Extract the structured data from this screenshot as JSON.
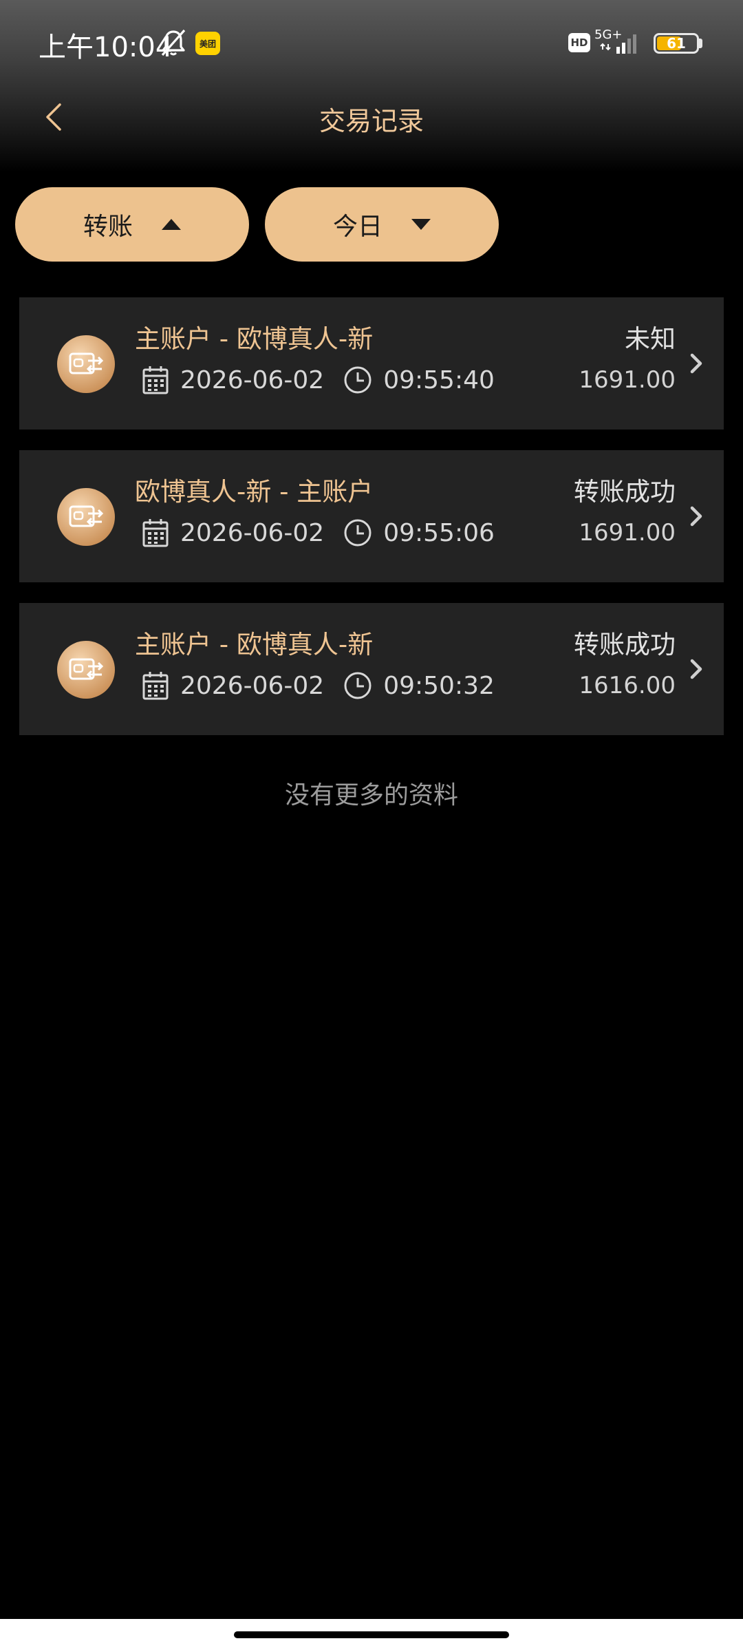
{
  "status_bar": {
    "time": "上午10:04",
    "app_badge": "美团",
    "hd_label": "HD",
    "network": "5G+",
    "battery": "61"
  },
  "nav": {
    "title": "交易记录"
  },
  "filters": {
    "type_label": "转账",
    "date_label": "今日"
  },
  "records": [
    {
      "title": "主账户 - 欧博真人-新",
      "date": "2026-06-02",
      "time": "09:55:40",
      "status": "未知",
      "amount": "1691.00"
    },
    {
      "title": "欧博真人-新 - 主账户",
      "date": "2026-06-02",
      "time": "09:55:06",
      "status": "转账成功",
      "amount": "1691.00"
    },
    {
      "title": "主账户 - 欧博真人-新",
      "date": "2026-06-02",
      "time": "09:50:32",
      "status": "转账成功",
      "amount": "1616.00"
    }
  ],
  "footer": {
    "no_more_text": "没有更多的资料"
  },
  "colors": {
    "accent": "#edc28e",
    "title_gold": "#efc492",
    "card_bg": "#232323",
    "page_bg": "#000000"
  },
  "icons": {
    "back": "chevron-left-icon",
    "transfer": "transfer-icon",
    "calendar": "calendar-icon",
    "clock": "clock-icon",
    "chevron": "chevron-right-icon"
  }
}
